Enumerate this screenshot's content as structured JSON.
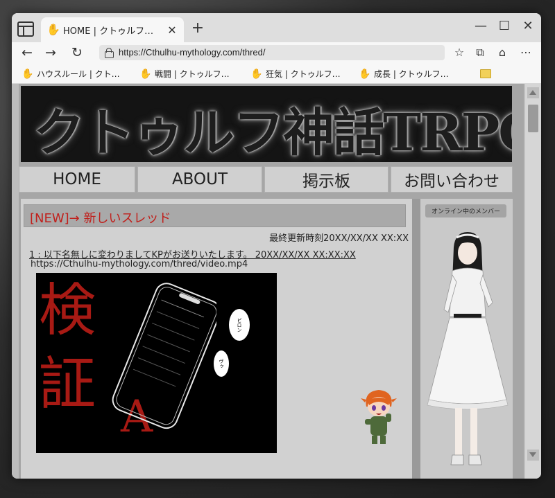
{
  "browser": {
    "tab_title": "HOME | クトゥルフ…",
    "url": "https://Cthulhu-mythology.com/thred/",
    "bookmarks": [
      {
        "label": "ハウスルール | クト…"
      },
      {
        "label": "戦闘 | クトゥルフ…"
      },
      {
        "label": "狂気 | クトゥルフ…"
      },
      {
        "label": "成長 | クトゥルフ…"
      }
    ],
    "icons": {
      "tab": "bloody-hand-icon",
      "back": "back-arrow-icon",
      "forward": "forward-arrow-icon",
      "refresh": "refresh-icon",
      "favorite": "star-icon",
      "collections": "add-favorite-icon",
      "extensions": "game-icon",
      "menu": "more-icon"
    }
  },
  "site": {
    "banner_title": "クトゥルフ神話TRPG",
    "nav": [
      "HOME",
      "ABOUT",
      "掲示板",
      "お問い合わせ"
    ]
  },
  "thread": {
    "title": "[NEW]→ 新しいスレッド",
    "last_updated": "最終更新時刻20XX/XX/XX XX:XX",
    "post_header": "1 : 以下名無しに変わりましてKPがお送りいたします。 20XX/XX/XX XX:XX:XX",
    "post_url": "https://Cthulhu-mythology.com/thred/video.mp4",
    "video": {
      "line1": "検",
      "line2": "証",
      "line3": "A",
      "bubble1": "ピロン",
      "bubble2": "ヴゥ"
    }
  },
  "sidebar": {
    "members_label": "オンライン中のメンバー"
  },
  "colors": {
    "accent_red": "#c0201c",
    "video_red": "#a81a14",
    "chrome": "#f3f3f3",
    "page_bg": "#a6a6a6"
  }
}
